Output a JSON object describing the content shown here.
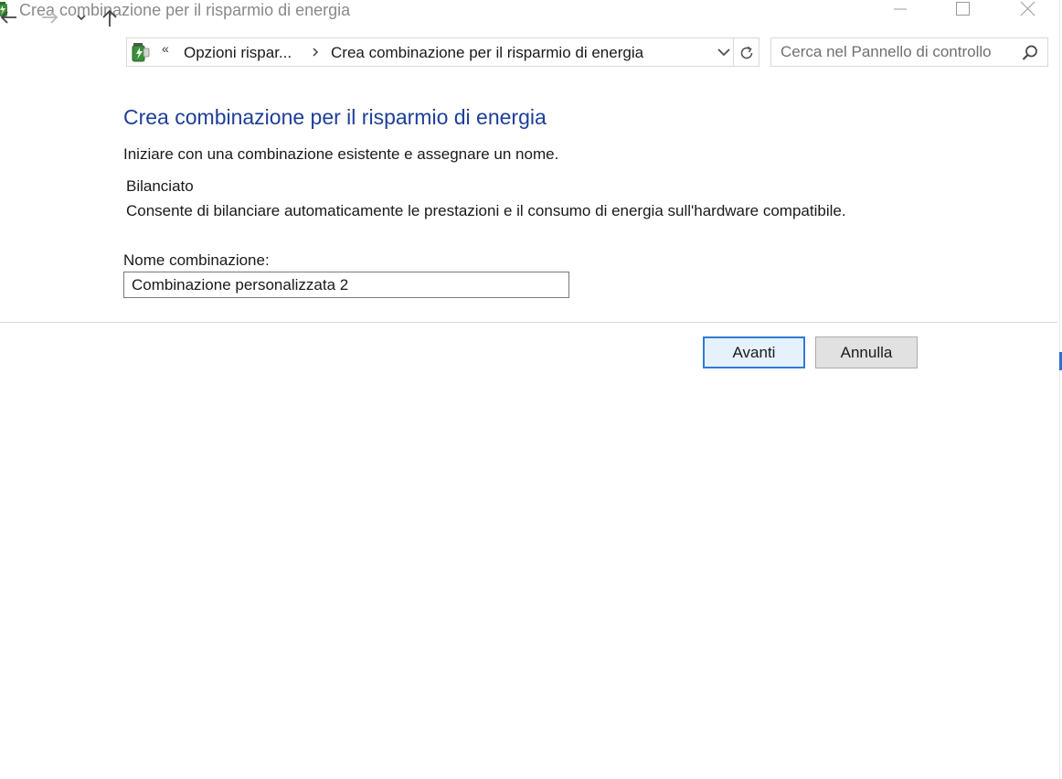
{
  "window": {
    "title": "Crea combinazione per il risparmio di energia",
    "controls": [
      "minimize",
      "maximize",
      "close"
    ]
  },
  "nav": {
    "back_icon": "arrow-left-icon",
    "forward_icon": "arrow-right-icon",
    "recent_icon": "chevron-down-icon",
    "up_icon": "arrow-up-icon"
  },
  "address": {
    "overflow_chevron": "«",
    "breadcrumbs": [
      "Opzioni rispar...",
      "Crea combinazione per il risparmio di energia"
    ],
    "separator_icon": "chevron-right-icon",
    "dropdown_icon": "chevron-down-icon"
  },
  "refresh_icon": "refresh-icon",
  "search": {
    "placeholder": "Cerca nel Pannello di controllo",
    "icon": "search-icon"
  },
  "main": {
    "title": "Crea combinazione per il risparmio di energia",
    "intro": "Iniziare con una combinazione esistente e assegnare un nome.",
    "plan_name": "Bilanciato",
    "plan_description": "Consente di bilanciare automaticamente le prestazioni e il consumo di energia sull'hardware compatibile.",
    "name_label": "Nome combinazione:",
    "name_value": "Combinazione personalizzata 2"
  },
  "buttons": {
    "next": "Avanti",
    "cancel": "Annulla"
  },
  "colors": {
    "title_blue": "#1e3f9a",
    "focus_blue": "#2f7bd1",
    "app_icon_green": "#3a8f3a"
  }
}
